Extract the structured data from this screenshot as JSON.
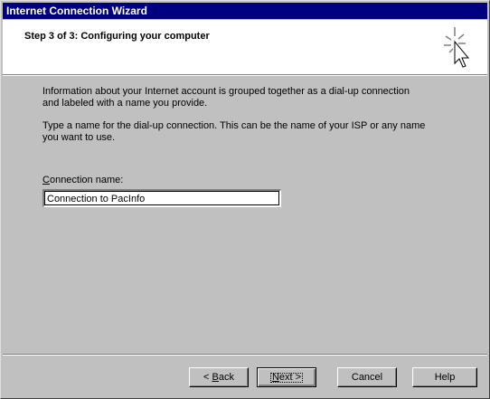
{
  "window": {
    "title": "Internet Connection Wizard"
  },
  "header": {
    "step_title": "Step 3 of 3: Configuring your computer",
    "icon": "wizard-cursor-icon"
  },
  "content": {
    "paragraph1_line1": "Information about your Internet account is grouped together as a dial-up connection",
    "paragraph1_line2": "and labeled with a name you provide.",
    "paragraph2_line1": "Type a name for the dial-up connection. This can be the name of your ISP or any name",
    "paragraph2_line2": "you want to use.",
    "connection_label_mnemonic": "C",
    "connection_label_rest": "onnection name:",
    "connection_name_value": "Connection to PacInfo"
  },
  "buttons": {
    "back_prefix": "< ",
    "back_mnemonic": "B",
    "back_rest": "ack",
    "next_mnemonic": "N",
    "next_rest": "ext >",
    "cancel": "Cancel",
    "help": "Help"
  }
}
